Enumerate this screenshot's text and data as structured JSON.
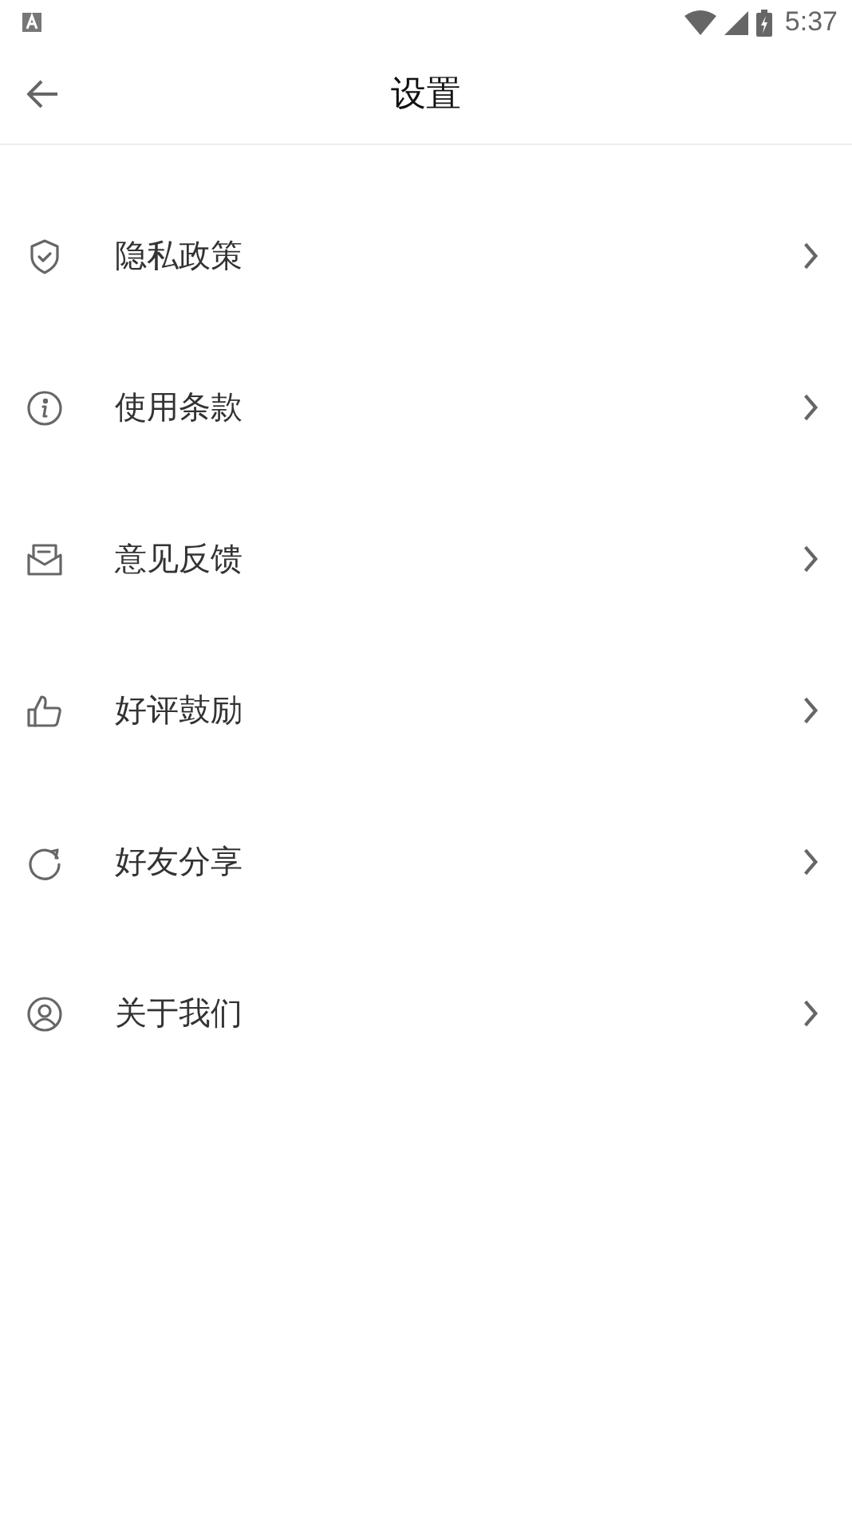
{
  "status_bar": {
    "time": "5:37"
  },
  "header": {
    "title": "设置"
  },
  "menu": [
    {
      "label": "隐私政策"
    },
    {
      "label": "使用条款"
    },
    {
      "label": "意见反馈"
    },
    {
      "label": "好评鼓励"
    },
    {
      "label": "好友分享"
    },
    {
      "label": "关于我们"
    }
  ]
}
